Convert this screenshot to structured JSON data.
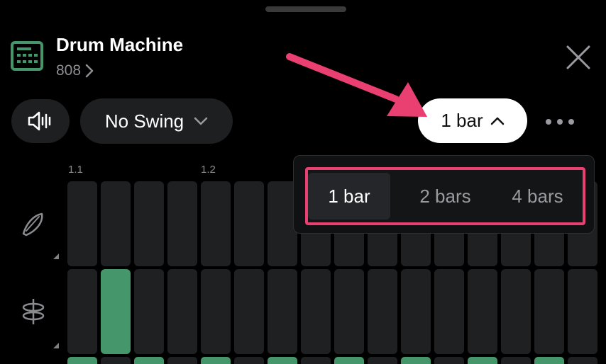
{
  "header": {
    "title": "Drum Machine",
    "subtitle": "808",
    "accent_color": "#45966a"
  },
  "toolbar": {
    "volume_icon": "speaker-icon",
    "swing_label": "No Swing",
    "bar_label": "1 bar"
  },
  "ruler": {
    "markers": [
      "1.1",
      "1.2"
    ]
  },
  "dropdown": {
    "options": [
      "1 bar",
      "2 bars",
      "4 bars"
    ],
    "selected": "1 bar",
    "highlight_color": "#ea3f71"
  },
  "rows": [
    {
      "icon": "hi-hat-icon",
      "steps": [
        false,
        false,
        false,
        false,
        false,
        false,
        false,
        false,
        false,
        false,
        false,
        false,
        false,
        false,
        false,
        false
      ]
    },
    {
      "icon": "snare-icon",
      "steps": [
        false,
        true,
        false,
        false,
        false,
        false,
        false,
        false,
        false,
        false,
        false,
        false,
        false,
        false,
        false,
        false
      ]
    },
    {
      "icon": "kick-icon",
      "steps": [
        true,
        false,
        true,
        false,
        true,
        false,
        true,
        false,
        true,
        false,
        true,
        false,
        true,
        false,
        true,
        false
      ]
    }
  ]
}
